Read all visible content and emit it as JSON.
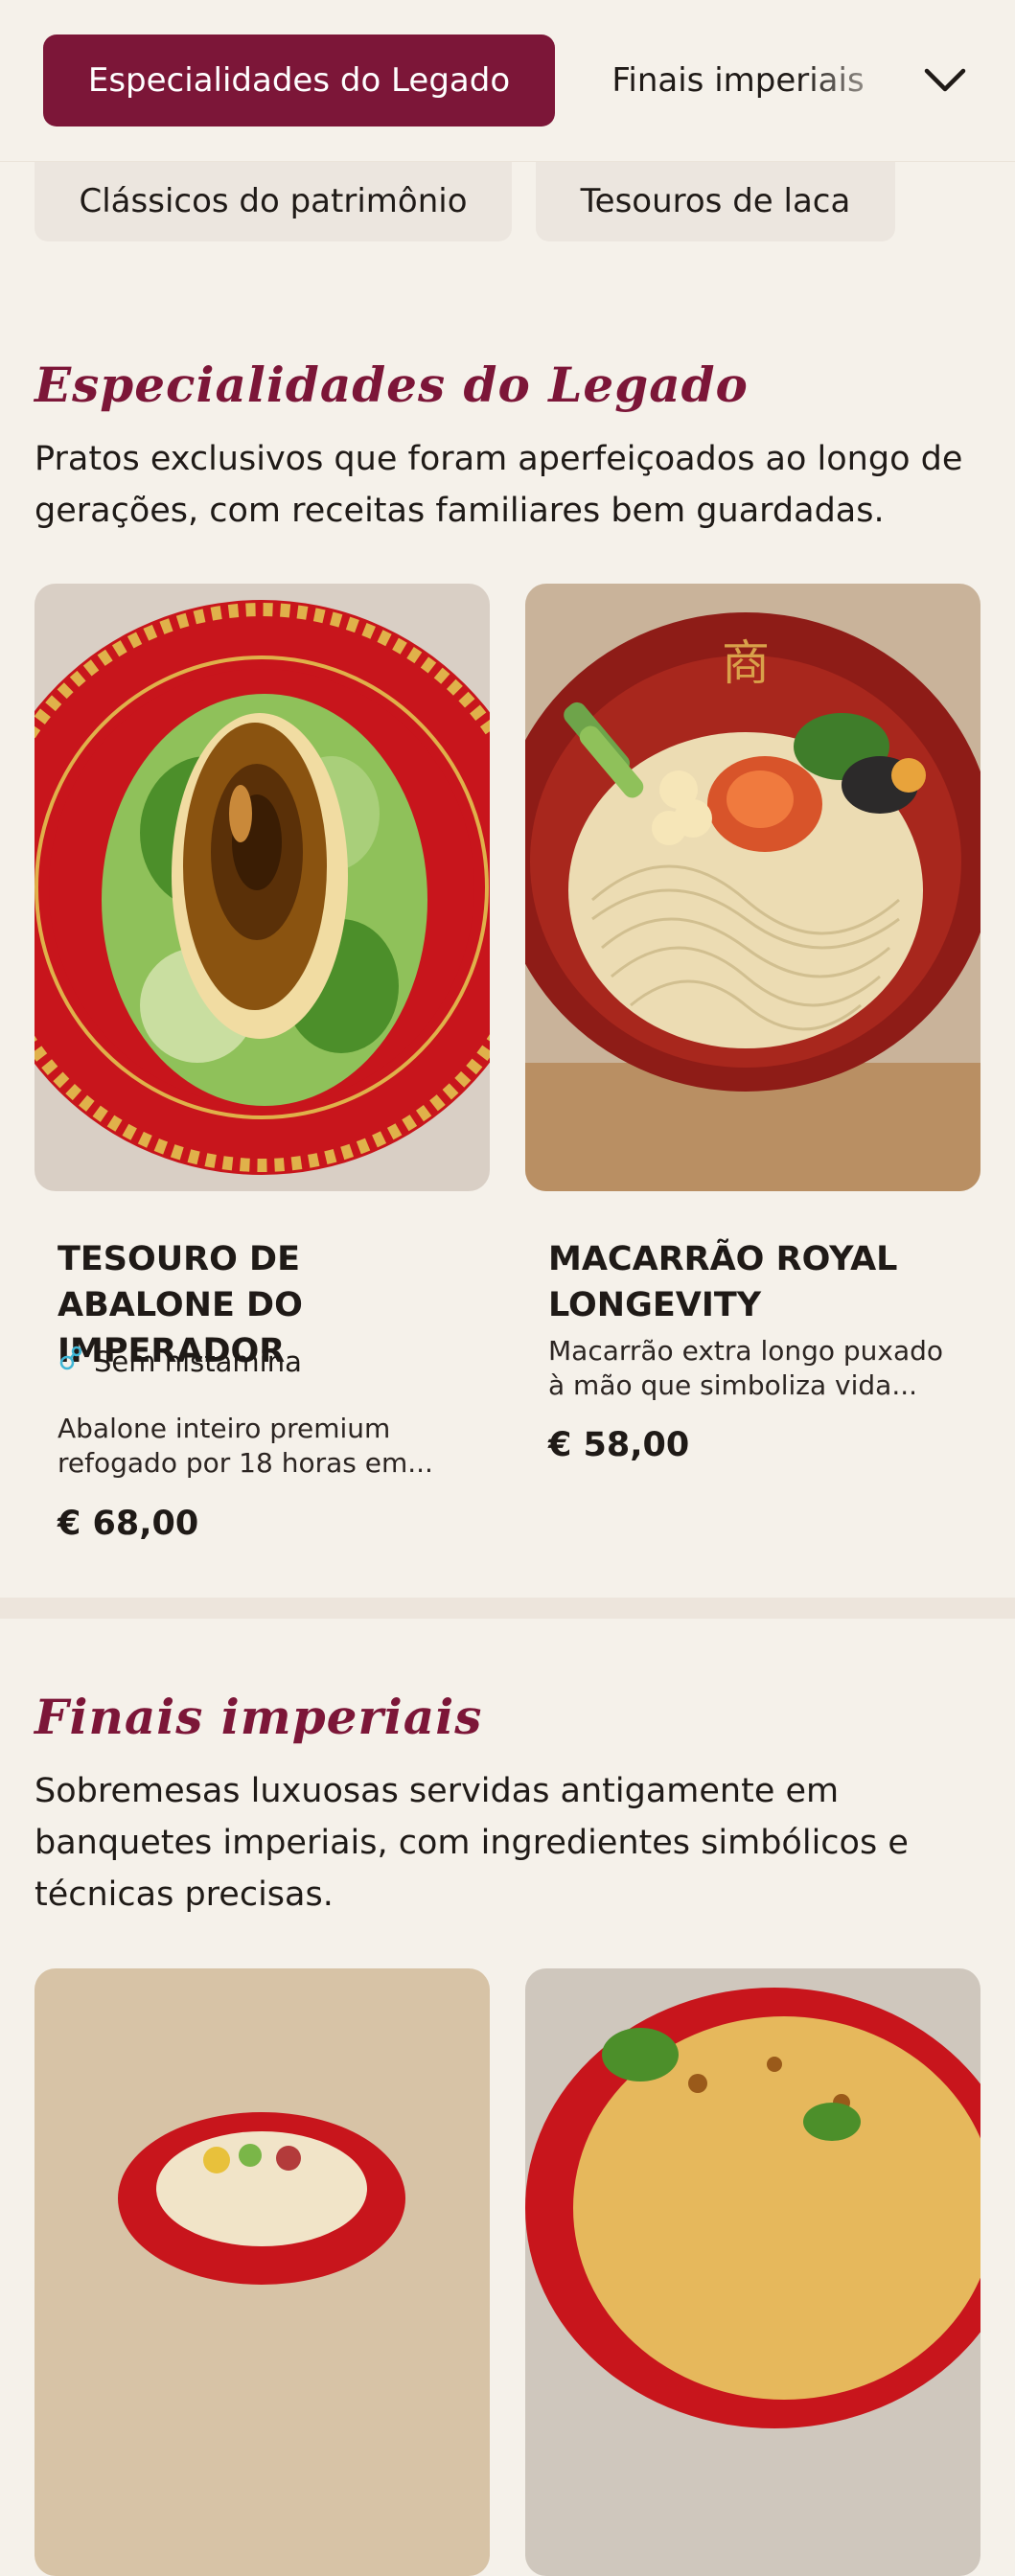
{
  "nav": {
    "active_tab": "Especialidades do Legado",
    "next_tab": "Finais imperiais",
    "secondary_tabs": [
      "Clássicos do patrimônio",
      "Tesouros de laca"
    ]
  },
  "sections": [
    {
      "title": "Especialidades do Legado",
      "description": "Pratos exclusivos que foram aperfeiçoados ao longo de gerações, com receitas familiares bem guardadas.",
      "items": [
        {
          "name": "TESOURO DE ABALONE DO IMPERADOR",
          "diet_label": "Sem histamina",
          "description": "Abalone inteiro premium refogado por 18 horas em...",
          "price": "€ 68,00"
        },
        {
          "name": "MACARRÃO ROYAL LONGEVITY",
          "description": "Macarrão extra longo puxado à mão que simboliza vida...",
          "price": "€ 58,00"
        }
      ]
    },
    {
      "title": "Finais imperiais",
      "description": "Sobremesas luxuosas servidas antigamente em banquetes imperiais, com ingredientes simbólicos e técnicas precisas."
    }
  ],
  "icons": {
    "dropdown": "chevron-down-icon",
    "diet": "histamine-free-icon"
  },
  "colors": {
    "accent": "#7c1638",
    "background": "#f5f1ea",
    "plate_red": "#c8151c",
    "plate_gold": "#e0b14a"
  }
}
